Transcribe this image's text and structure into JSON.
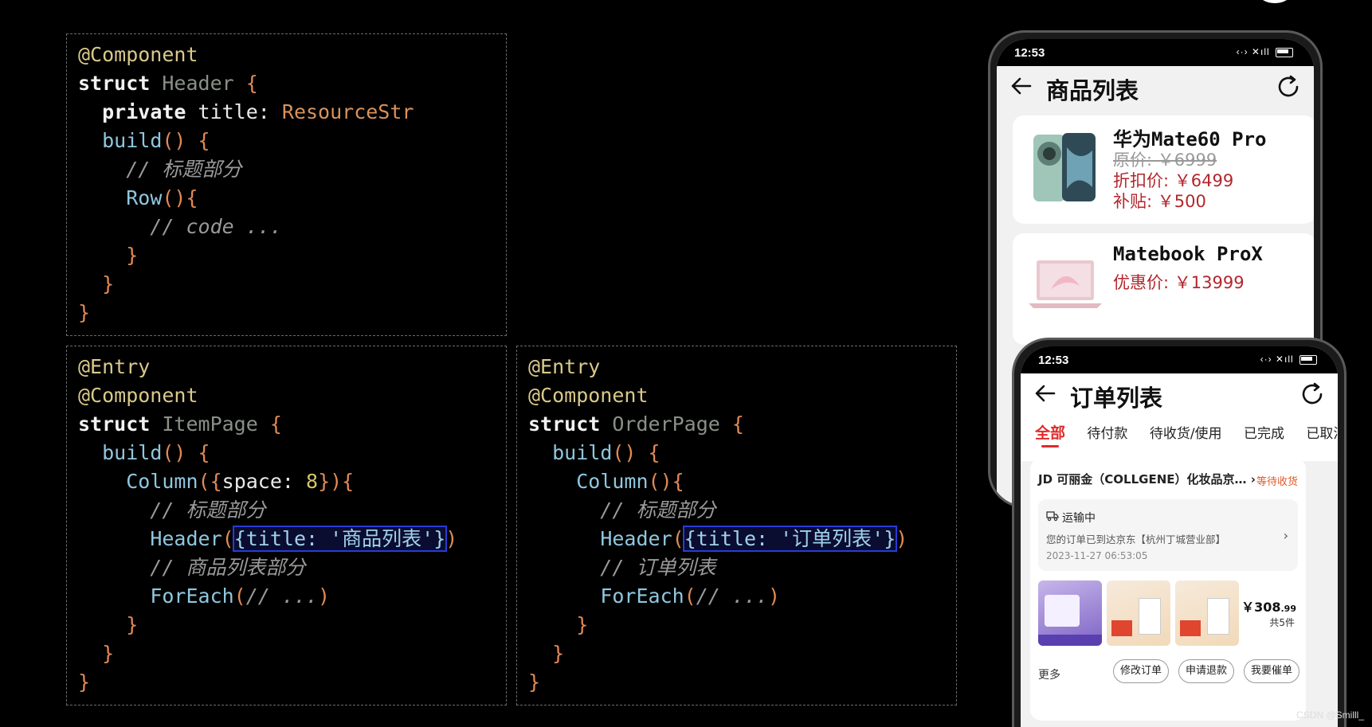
{
  "code_header": {
    "lines": [
      [
        {
          "t": "@Component",
          "c": "dec"
        }
      ],
      [
        {
          "t": "struct",
          "c": "kw"
        },
        {
          "t": " Header ",
          "c": "type"
        },
        {
          "t": "{",
          "c": "paren"
        }
      ],
      [
        {
          "t": "  "
        },
        {
          "t": "private",
          "c": "kw"
        },
        {
          "t": " title: ",
          "c": "plain"
        },
        {
          "t": "ResourceStr",
          "c": "res"
        }
      ],
      [
        {
          "t": "  "
        },
        {
          "t": "build",
          "c": "fn"
        },
        {
          "t": "() {",
          "c": "paren"
        }
      ],
      [
        {
          "t": "    // 标题部分",
          "c": "cmt"
        }
      ],
      [
        {
          "t": "    "
        },
        {
          "t": "Row",
          "c": "fn"
        },
        {
          "t": "(){",
          "c": "paren"
        }
      ],
      [
        {
          "t": "      // code ...",
          "c": "cmt"
        }
      ],
      [
        {
          "t": "    "
        },
        {
          "t": "}",
          "c": "paren"
        }
      ],
      [
        {
          "t": "  "
        },
        {
          "t": "}",
          "c": "paren"
        }
      ],
      [
        {
          "t": "}",
          "c": "paren"
        }
      ]
    ]
  },
  "code_item": {
    "lines": [
      [
        {
          "t": "@Entry",
          "c": "dec"
        }
      ],
      [
        {
          "t": "@Component",
          "c": "dec"
        }
      ],
      [
        {
          "t": "struct",
          "c": "kw"
        },
        {
          "t": " ItemPage ",
          "c": "type"
        },
        {
          "t": "{",
          "c": "paren"
        }
      ],
      [
        {
          "t": "  "
        },
        {
          "t": "build",
          "c": "fn"
        },
        {
          "t": "() {",
          "c": "paren"
        }
      ],
      [
        {
          "t": "    "
        },
        {
          "t": "Column",
          "c": "fn"
        },
        {
          "t": "({",
          "c": "paren"
        },
        {
          "t": "space: ",
          "c": "plain"
        },
        {
          "t": "8",
          "c": "num"
        },
        {
          "t": "}){",
          "c": "paren"
        }
      ],
      [
        {
          "t": "      // 标题部分",
          "c": "cmt"
        }
      ],
      [
        {
          "t": "      "
        },
        {
          "t": "Header",
          "c": "fn"
        },
        {
          "t": "(",
          "c": "paren"
        },
        {
          "t": "{title: '商品列表'}",
          "c": "str",
          "hl": true
        },
        {
          "t": ")",
          "c": "paren"
        }
      ],
      [
        {
          "t": "      // 商品列表部分",
          "c": "cmt"
        }
      ],
      [
        {
          "t": "      "
        },
        {
          "t": "ForEach",
          "c": "fn"
        },
        {
          "t": "(",
          "c": "paren"
        },
        {
          "t": "// ...",
          "c": "cmt"
        },
        {
          "t": ")",
          "c": "paren"
        }
      ],
      [
        {
          "t": "    "
        },
        {
          "t": "}",
          "c": "paren"
        }
      ],
      [
        {
          "t": "  "
        },
        {
          "t": "}",
          "c": "paren"
        }
      ],
      [
        {
          "t": "}",
          "c": "paren"
        }
      ]
    ]
  },
  "code_order": {
    "lines": [
      [
        {
          "t": "@Entry",
          "c": "dec"
        }
      ],
      [
        {
          "t": "@Component",
          "c": "dec"
        }
      ],
      [
        {
          "t": "struct",
          "c": "kw"
        },
        {
          "t": " OrderPage ",
          "c": "type"
        },
        {
          "t": "{",
          "c": "paren"
        }
      ],
      [
        {
          "t": "  "
        },
        {
          "t": "build",
          "c": "fn"
        },
        {
          "t": "() {",
          "c": "paren"
        }
      ],
      [
        {
          "t": "    "
        },
        {
          "t": "Column",
          "c": "fn"
        },
        {
          "t": "(){",
          "c": "paren"
        }
      ],
      [
        {
          "t": "      // 标题部分",
          "c": "cmt"
        }
      ],
      [
        {
          "t": "      "
        },
        {
          "t": "Header",
          "c": "fn"
        },
        {
          "t": "(",
          "c": "paren"
        },
        {
          "t": "{title: '订单列表'}",
          "c": "str",
          "hl": true
        },
        {
          "t": ")",
          "c": "paren"
        }
      ],
      [
        {
          "t": "      // 订单列表",
          "c": "cmt"
        }
      ],
      [
        {
          "t": "      "
        },
        {
          "t": "ForEach",
          "c": "fn"
        },
        {
          "t": "(",
          "c": "paren"
        },
        {
          "t": "// ...",
          "c": "cmt"
        },
        {
          "t": ")",
          "c": "paren"
        }
      ],
      [
        {
          "t": "    "
        },
        {
          "t": "}",
          "c": "paren"
        }
      ],
      [
        {
          "t": "  "
        },
        {
          "t": "}",
          "c": "paren"
        }
      ],
      [
        {
          "t": "}",
          "c": "paren"
        }
      ]
    ]
  },
  "phone1": {
    "time": "12:53",
    "title": "商品列表",
    "products": [
      {
        "name": "华为Mate60 Pro",
        "orig": "原价: ￥6999",
        "discount": "折扣价: ￥6499",
        "subsidy": "补贴: ￥500"
      },
      {
        "name": "Matebook ProX",
        "promo": "优惠价: ￥13999"
      }
    ]
  },
  "phone2": {
    "time": "12:53",
    "title": "订单列表",
    "tabs": [
      "全部",
      "待付款",
      "待收货/使用",
      "已完成",
      "已取消"
    ],
    "shop": "JD 可丽金（COLLGENE）化妆品京…",
    "shop_status": "等待收货",
    "shipping_status": "运输中",
    "shipping_detail": "您的订单已到达京东【杭州丁城营业部】",
    "shipping_time": "2023-11-27 06:53:05",
    "price_main": "￥308",
    "price_cents": ".99",
    "count": "共5件",
    "more": "更多",
    "buttons": [
      "修改订单",
      "申请退款",
      "我要催单"
    ]
  },
  "watermark": "CSDN @Smilll_"
}
